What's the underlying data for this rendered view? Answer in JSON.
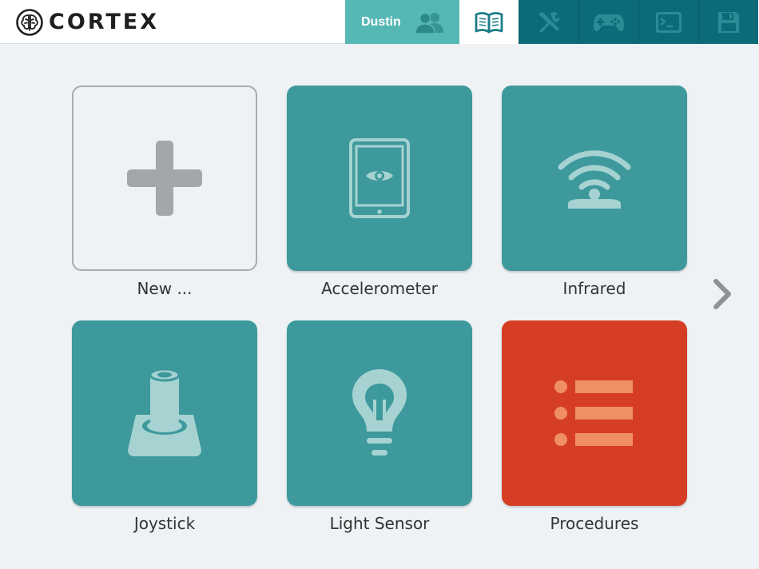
{
  "app": {
    "brand_name": "CORTEX"
  },
  "header": {
    "user_tab_label": "Dustin",
    "tabs": [
      {
        "icon": "people-icon"
      },
      {
        "icon": "open-book-icon"
      },
      {
        "icon": "tools-icon"
      },
      {
        "icon": "gamepad-icon"
      },
      {
        "icon": "terminal-icon"
      },
      {
        "icon": "save-disk-icon"
      }
    ]
  },
  "tiles": [
    {
      "label": "New ...",
      "icon": "plus-icon",
      "style": "outline"
    },
    {
      "label": "Accelerometer",
      "icon": "tablet-eye-icon",
      "style": "teal"
    },
    {
      "label": "Infrared",
      "icon": "infrared-signal-icon",
      "style": "teal"
    },
    {
      "label": "Joystick",
      "icon": "joystick-icon",
      "style": "teal"
    },
    {
      "label": "Light Sensor",
      "icon": "light-bulb-icon",
      "style": "teal"
    },
    {
      "label": "Procedures",
      "icon": "list-icon",
      "style": "red"
    }
  ],
  "colors": {
    "teal_tile": "#3e999c",
    "red_tile": "#d53e24",
    "header_dark": "#0d6b79",
    "header_user": "#56b8b5",
    "icon_light": "#a6d3d2"
  }
}
